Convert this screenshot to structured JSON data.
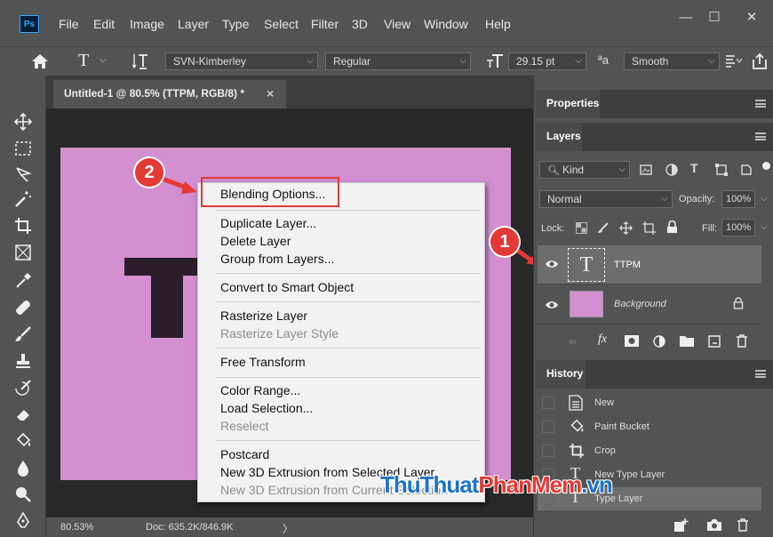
{
  "app": {
    "logo": "Ps"
  },
  "menubar": {
    "items": [
      "File",
      "Edit",
      "Image",
      "Layer",
      "Type",
      "Select",
      "Filter",
      "3D",
      "View",
      "Window",
      "Help"
    ],
    "window_controls": {
      "minimize": "—",
      "maximize": "☐",
      "close": "✕"
    }
  },
  "options": {
    "font_family": "SVN-Kimberley",
    "font_style": "Regular",
    "font_size": "29.15 pt",
    "aa_label": "ªa",
    "antialias": "Smooth"
  },
  "document": {
    "tab_title": "Untitled-1 @ 80.5% (TTPM, RGB/8) *",
    "tab_close": "×",
    "zoom": "80.53%",
    "doc_info": "Doc: 635.2K/846.9K",
    "canvas_color": "#d38fd0"
  },
  "context_menu": {
    "groups": [
      [
        {
          "label": "Blending Options...",
          "enabled": true
        }
      ],
      [
        {
          "label": "Duplicate Layer...",
          "enabled": true
        },
        {
          "label": "Delete Layer",
          "enabled": true
        },
        {
          "label": "Group from Layers...",
          "enabled": true
        }
      ],
      [
        {
          "label": "Convert to Smart Object",
          "enabled": true
        }
      ],
      [
        {
          "label": "Rasterize Layer",
          "enabled": true
        },
        {
          "label": "Rasterize Layer Style",
          "enabled": false
        }
      ],
      [
        {
          "label": "Free Transform",
          "enabled": true
        }
      ],
      [
        {
          "label": "Color Range...",
          "enabled": true
        },
        {
          "label": "Load Selection...",
          "enabled": true
        },
        {
          "label": "Reselect",
          "enabled": false
        }
      ],
      [
        {
          "label": "Postcard",
          "enabled": true
        },
        {
          "label": "New 3D Extrusion from Selected Layer",
          "enabled": true
        },
        {
          "label": "New 3D Extrusion from Current Selection",
          "enabled": false
        }
      ]
    ]
  },
  "annotations": {
    "step1": "1",
    "step2": "2",
    "highlight_color": "#e53935"
  },
  "panels": {
    "properties": {
      "title": "Properties"
    },
    "layers": {
      "title": "Layers",
      "filter": "Kind",
      "blend_mode": "Normal",
      "opacity_label": "Opacity:",
      "opacity": "100%",
      "lock_label": "Lock:",
      "fill_label": "Fill:",
      "fill": "100%",
      "rows": [
        {
          "name": "TTPM",
          "thumb": "T",
          "selected": true
        },
        {
          "name": "Background",
          "selected": false,
          "locked": true
        }
      ]
    },
    "history": {
      "title": "History",
      "items": [
        {
          "label": "New",
          "icon": "document-icon"
        },
        {
          "label": "Paint Bucket",
          "icon": "paint-bucket-icon"
        },
        {
          "label": "Crop",
          "icon": "crop-icon"
        },
        {
          "label": "New Type Layer",
          "icon": "type-icon"
        },
        {
          "label": "Type Layer",
          "icon": "type-icon"
        }
      ]
    }
  },
  "watermark": {
    "part1": "ThuThuat",
    "part2": "PhanMem",
    "part3": ".vn"
  }
}
